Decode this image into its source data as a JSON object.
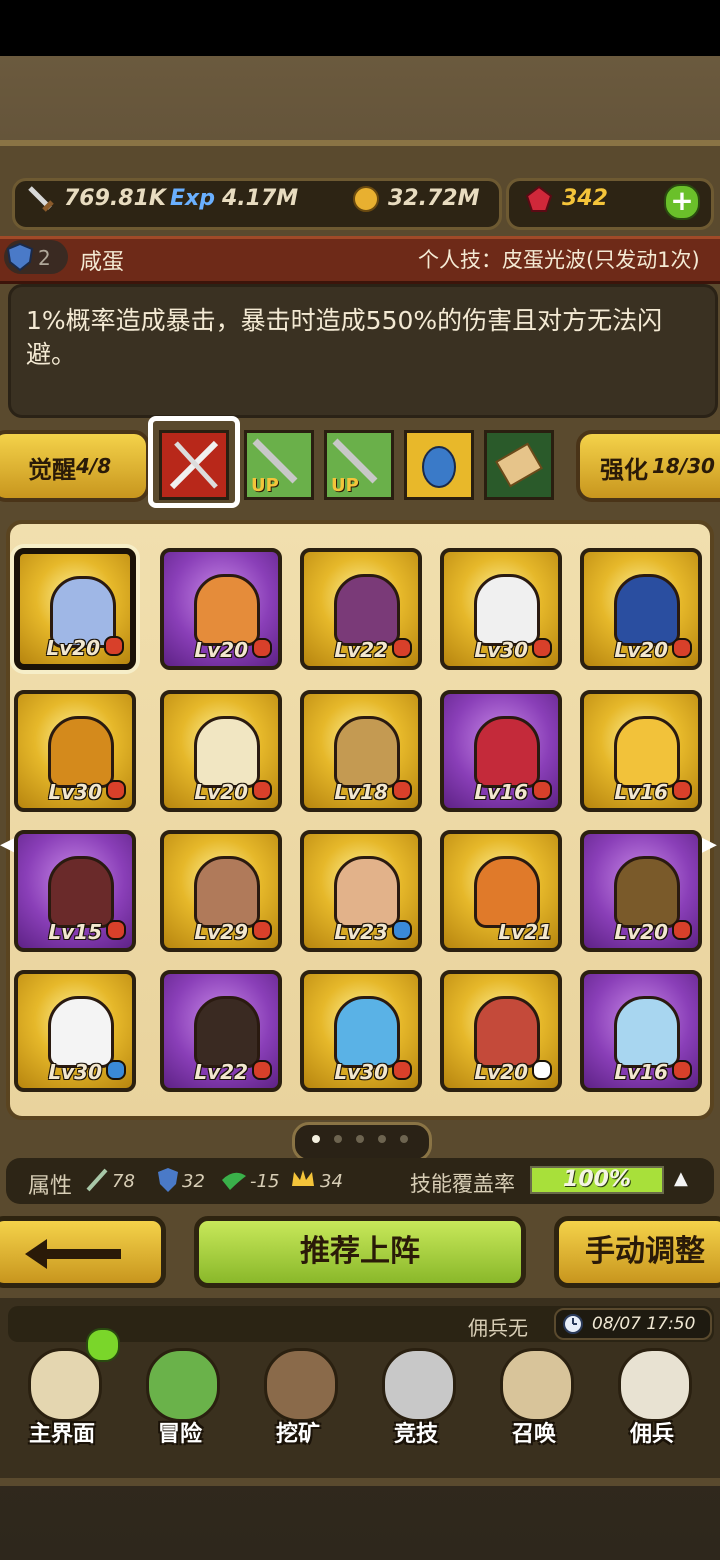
{
  "resources": {
    "attack": "769.81K",
    "exp_label": "Exp",
    "exp": "4.17M",
    "gold": "32.72M",
    "gems": "342"
  },
  "hero": {
    "shield_level": "2",
    "name": "咸蛋",
    "skill_title": "个人技：皮蛋光波(只发动1次)",
    "description": "1%概率造成暴击，暴击时造成550%的伤害且对方无法闪避。"
  },
  "awaken": {
    "label": "觉醒",
    "value": "4/8"
  },
  "enhance": {
    "label": "强化",
    "value": "18/30"
  },
  "skill_slots": [
    {
      "name": "crossed-swords-icon"
    },
    {
      "name": "sword-up-icon",
      "badge": "UP"
    },
    {
      "name": "sword-up-icon",
      "badge": "UP"
    },
    {
      "name": "blue-egg-icon"
    },
    {
      "name": "scroll-icon"
    }
  ],
  "heroes": [
    {
      "lv": "Lv20",
      "rarity": "gold",
      "selected": true,
      "color": "#9fb7e6",
      "tag": "red"
    },
    {
      "lv": "Lv20",
      "rarity": "purple",
      "color": "#e58c3a",
      "tag": "red"
    },
    {
      "lv": "Lv22",
      "rarity": "gold",
      "color": "#7a3a78",
      "tag": "red"
    },
    {
      "lv": "Lv30",
      "rarity": "gold",
      "color": "#f0f0f0",
      "tag": "red"
    },
    {
      "lv": "Lv20",
      "rarity": "gold",
      "color": "#2a4ea0",
      "tag": "red"
    },
    {
      "lv": "Lv30",
      "rarity": "gold",
      "color": "#d48a1c",
      "tag": "red"
    },
    {
      "lv": "Lv20",
      "rarity": "gold",
      "color": "#f1e6c2",
      "tag": "red"
    },
    {
      "lv": "Lv18",
      "rarity": "gold",
      "color": "#c49a52",
      "tag": "red"
    },
    {
      "lv": "Lv16",
      "rarity": "purple",
      "color": "#c42a3a",
      "tag": "red"
    },
    {
      "lv": "Lv16",
      "rarity": "gold",
      "color": "#f2c23a",
      "tag": "red"
    },
    {
      "lv": "Lv15",
      "rarity": "purple",
      "color": "#6a2a2a",
      "tag": "red"
    },
    {
      "lv": "Lv29",
      "rarity": "gold",
      "color": "#b07a5a",
      "tag": "red"
    },
    {
      "lv": "Lv23",
      "rarity": "gold",
      "color": "#e2b28a",
      "tag": "blue"
    },
    {
      "lv": "Lv21",
      "rarity": "gold",
      "color": "#e07a2a",
      "tag": "none"
    },
    {
      "lv": "Lv20",
      "rarity": "purple",
      "color": "#7a5a2a",
      "tag": "red"
    },
    {
      "lv": "Lv30",
      "rarity": "gold",
      "color": "#f4f4f4",
      "tag": "blue"
    },
    {
      "lv": "Lv22",
      "rarity": "purple",
      "color": "#3a2a22",
      "tag": "red"
    },
    {
      "lv": "Lv30",
      "rarity": "gold",
      "color": "#5ab2e6",
      "tag": "red"
    },
    {
      "lv": "Lv20",
      "rarity": "gold",
      "color": "#c44a3a",
      "tag": "question"
    },
    {
      "lv": "Lv16",
      "rarity": "purple",
      "color": "#a8d6f0",
      "tag": "red"
    }
  ],
  "pages": {
    "count": 5,
    "current": 1
  },
  "attributes": {
    "label": "属性",
    "values": [
      "78",
      "32",
      "-15",
      "34"
    ],
    "coverage_label": "技能覆盖率",
    "coverage_value": "100%",
    "coverage_fraction": 1.0
  },
  "buttons": {
    "recommend": "推荐上阵",
    "manual": "手动调整"
  },
  "info": {
    "mercenary_text": "佣兵无",
    "timestamp": "08/07 17:50"
  },
  "nav": [
    {
      "label": "主界面",
      "icon": "map-scroll-icon",
      "color": "#e4d6b0"
    },
    {
      "label": "冒险",
      "icon": "island-icon",
      "color": "#6ab24a"
    },
    {
      "label": "挖矿",
      "icon": "pickaxe-icon",
      "color": "#8a6a4a"
    },
    {
      "label": "竞技",
      "icon": "crossed-swords-icon",
      "color": "#c8c8c8"
    },
    {
      "label": "召唤",
      "icon": "summon-scroll-icon",
      "color": "#d8c49a"
    },
    {
      "label": "佣兵",
      "icon": "tent-icon",
      "color": "#e8e2d2"
    }
  ],
  "colors": {
    "accent_gold": "#f4d24a",
    "accent_green": "#a8e03a",
    "purple": "#8a3fb8"
  }
}
